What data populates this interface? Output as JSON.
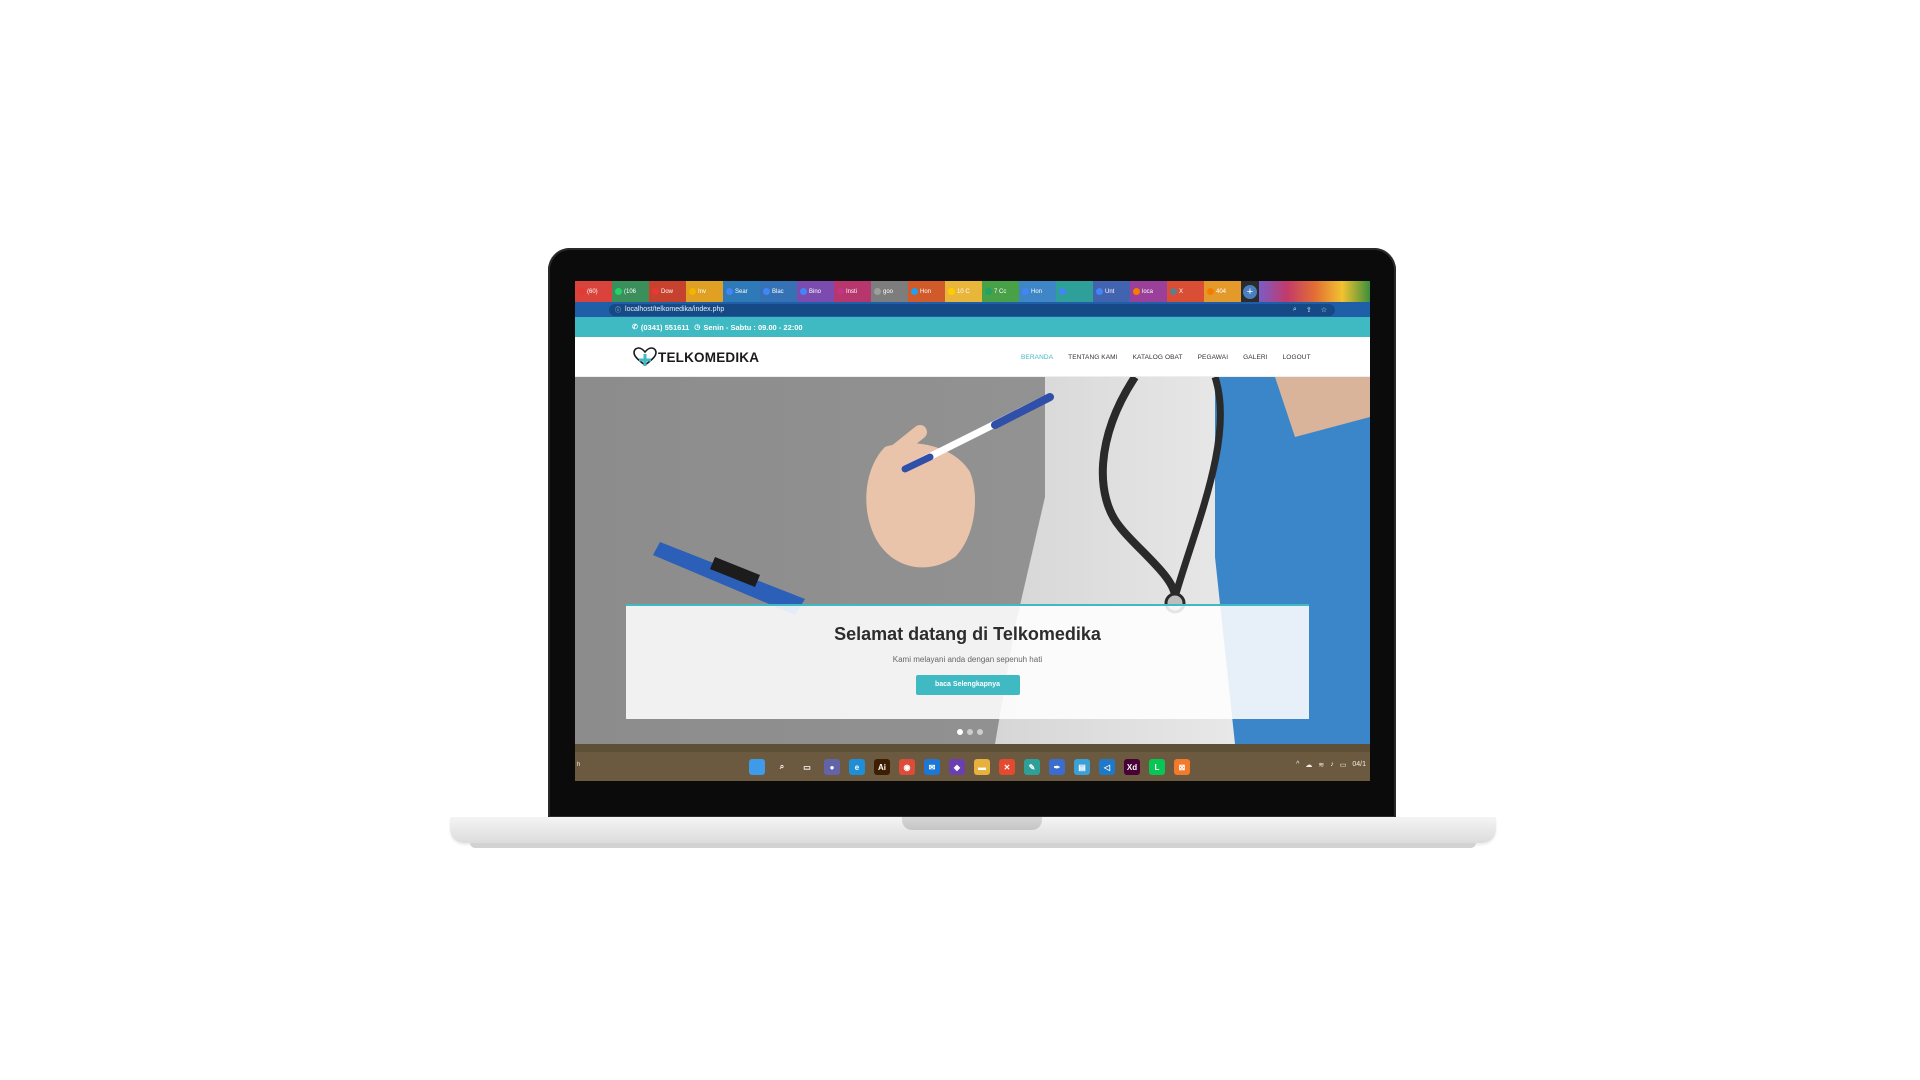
{
  "browser": {
    "tabs": [
      {
        "label": "(60)",
        "color": "#e53935"
      },
      {
        "label": "(106",
        "color": "#25d366"
      },
      {
        "label": "Dow",
        "color": "#e53935"
      },
      {
        "label": "Inv",
        "color": "#f4b400"
      },
      {
        "label": "Sear",
        "color": "#4285f4"
      },
      {
        "label": "Blac",
        "color": "#4285f4"
      },
      {
        "label": "Bino",
        "color": "#4285f4"
      },
      {
        "label": "Insti",
        "color": "#c13584"
      },
      {
        "label": "goo",
        "color": "#9e9e9e"
      },
      {
        "label": "Hon",
        "color": "#1da1f2"
      },
      {
        "label": "10 C",
        "color": "#ffcc00"
      },
      {
        "label": "7 Cc",
        "color": "#21a366"
      },
      {
        "label": "Hon",
        "color": "#4285f4"
      },
      {
        "label": "",
        "color": "#4285f4"
      },
      {
        "label": "Unt",
        "color": "#4285f4"
      },
      {
        "label": "loca",
        "color": "#f57c00"
      },
      {
        "label": "X",
        "color": "#607d8b"
      },
      {
        "label": "404",
        "color": "#f57c00"
      }
    ],
    "tab_colors": [
      "#d9433b",
      "#3a8f5a",
      "#c7422e",
      "#e0a023",
      "#2e79b8",
      "#3572b5",
      "#7b4bb0",
      "#b8366e",
      "#7d7d7d",
      "#d05a2a",
      "#e8b63b",
      "#48a047",
      "#3f86c7",
      "#2f9f9a",
      "#4263b0",
      "#9a3f9a",
      "#d94e34",
      "#e49a2b"
    ],
    "new_tab_label": "+",
    "url": "localhost/telkomedika/index.php"
  },
  "site": {
    "phone": "(0341) 551611",
    "hours": "Senin - Sabtu : 09.00 - 22:00",
    "brand": "TELKOMEDIKA",
    "nav": [
      "BERANDA",
      "TENTANG KAMI",
      "KATALOG OBAT",
      "PEGAWAI",
      "GALERI",
      "LOGOUT"
    ],
    "active_nav": "BERANDA",
    "accent_color": "#3fb9c2",
    "hero": {
      "title": "Selamat datang di Telkomedika",
      "subtitle": "Kami melayani anda dengan sepenuh hati",
      "button": "baca Selengkapnya",
      "slides": 3,
      "active_slide": 1
    }
  },
  "taskbar": {
    "apps": [
      {
        "name": "windows-start-icon",
        "label": "",
        "color": "#3d9be9"
      },
      {
        "name": "search-icon",
        "label": "⌕",
        "color": "transparent"
      },
      {
        "name": "task-view-icon",
        "label": "▭",
        "color": "transparent"
      },
      {
        "name": "chat-icon",
        "label": "●",
        "color": "#6264a7"
      },
      {
        "name": "edge-icon",
        "label": "e",
        "color": "#1e8fd6"
      },
      {
        "name": "illustrator-icon",
        "label": "Ai",
        "color": "#3d1e00"
      },
      {
        "name": "chrome-icon",
        "label": "◉",
        "color": "#dd4b39"
      },
      {
        "name": "mail-icon",
        "label": "✉",
        "color": "#1c78d4"
      },
      {
        "name": "visual-studio-icon",
        "label": "◆",
        "color": "#6c3fb0"
      },
      {
        "name": "file-explorer-icon",
        "label": "▬",
        "color": "#e8b03c"
      },
      {
        "name": "xampp-icon",
        "label": "✕",
        "color": "#e34a2f"
      },
      {
        "name": "paint-icon",
        "label": "✎",
        "color": "#2f9f9a"
      },
      {
        "name": "pen-tool-icon",
        "label": "✒",
        "color": "#3b6ccf"
      },
      {
        "name": "notepad-icon",
        "label": "▤",
        "color": "#3aa0d6"
      },
      {
        "name": "vscode-icon",
        "label": "◁",
        "color": "#1f78c8"
      },
      {
        "name": "xd-icon",
        "label": "Xd",
        "color": "#470137"
      },
      {
        "name": "line-icon",
        "label": "L",
        "color": "#06c755"
      },
      {
        "name": "xampp-panel-icon",
        "label": "⊠",
        "color": "#f47a2b"
      }
    ],
    "tray": [
      "^",
      "☁",
      "≋",
      "♪",
      "▭",
      "04/1"
    ]
  }
}
